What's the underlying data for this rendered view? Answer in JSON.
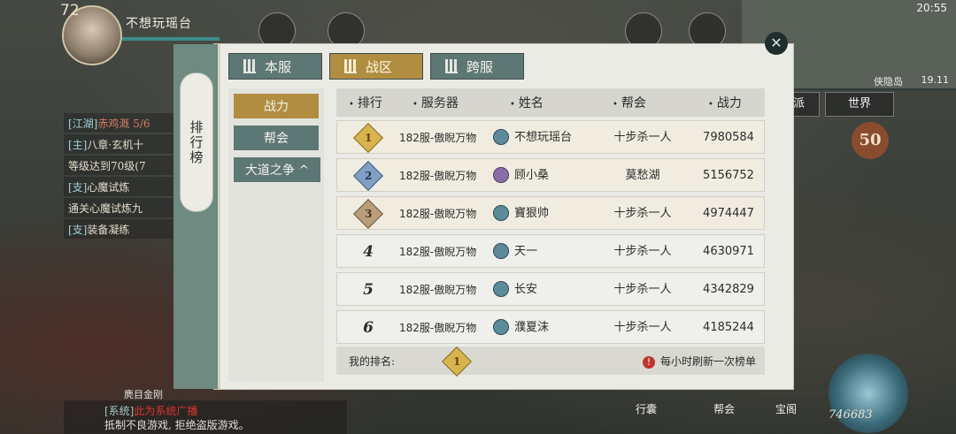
{
  "player": {
    "level": "72",
    "name": "不想玩瑶台"
  },
  "quests": [
    {
      "tag": "[江湖]",
      "text": "赤鸡溉 5/6"
    },
    {
      "tag": "[主]",
      "text": "八章·玄机十"
    },
    {
      "tag": "",
      "text": "等级达到70级(7"
    },
    {
      "tag": "[支]",
      "text": "心魔试炼"
    },
    {
      "tag": "",
      "text": "通关心魔试炼九"
    },
    {
      "tag": "[支]",
      "text": "装备凝练"
    }
  ],
  "status_bar": {
    "time": "20:55"
  },
  "minimap": {
    "place": "侠隐岛",
    "coords": "19.11"
  },
  "right_buttons": {
    "sect": "门派",
    "world": "世界"
  },
  "score_badge": "50",
  "chat": {
    "label": "麂目金刚",
    "line1_tag": "[系统]",
    "line1_text": "此为系统广播",
    "line2": "抵制不良游戏, 拒绝盗版游戏。"
  },
  "bottom_nav": [
    "行囊",
    "帮会",
    "宝阁"
  ],
  "combat_power": "746683",
  "panel": {
    "title": "排行榜",
    "close_icon": "✕",
    "tabs": [
      {
        "label": "本服",
        "active": false
      },
      {
        "label": "战区",
        "active": true
      },
      {
        "label": "跨服",
        "active": false
      }
    ],
    "categories": [
      {
        "label": "战力",
        "active": true
      },
      {
        "label": "帮会",
        "active": false
      },
      {
        "label": "大道之争 ^",
        "active": false
      }
    ],
    "headers": {
      "rank": "排行",
      "server": "服务器",
      "name": "姓名",
      "guild": "帮会",
      "power": "战力"
    },
    "rows": [
      {
        "rank": "1",
        "server": "182服-傲睨万物",
        "name": "不想玩瑶台",
        "guild": "十步杀一人",
        "power": "7980584"
      },
      {
        "rank": "2",
        "server": "182服-傲睨万物",
        "name": "顾小桑",
        "guild": "莫愁湖",
        "power": "5156752"
      },
      {
        "rank": "3",
        "server": "182服-傲睨万物",
        "name": "寶狠帅",
        "guild": "十步杀一人",
        "power": "4974447"
      },
      {
        "rank": "4",
        "server": "182服-傲睨万物",
        "name": "天一",
        "guild": "十步杀一人",
        "power": "4630971"
      },
      {
        "rank": "5",
        "server": "182服-傲睨万物",
        "name": "长安",
        "guild": "十步杀一人",
        "power": "4342829"
      },
      {
        "rank": "6",
        "server": "182服-傲睨万物",
        "name": "濮夏沫",
        "guild": "十步杀一人",
        "power": "4185244"
      }
    ],
    "footer": {
      "my_rank_label": "我的排名:",
      "my_rank": "1",
      "refresh_note": "每小时刷新一次榜单",
      "warn_icon": "!"
    }
  }
}
